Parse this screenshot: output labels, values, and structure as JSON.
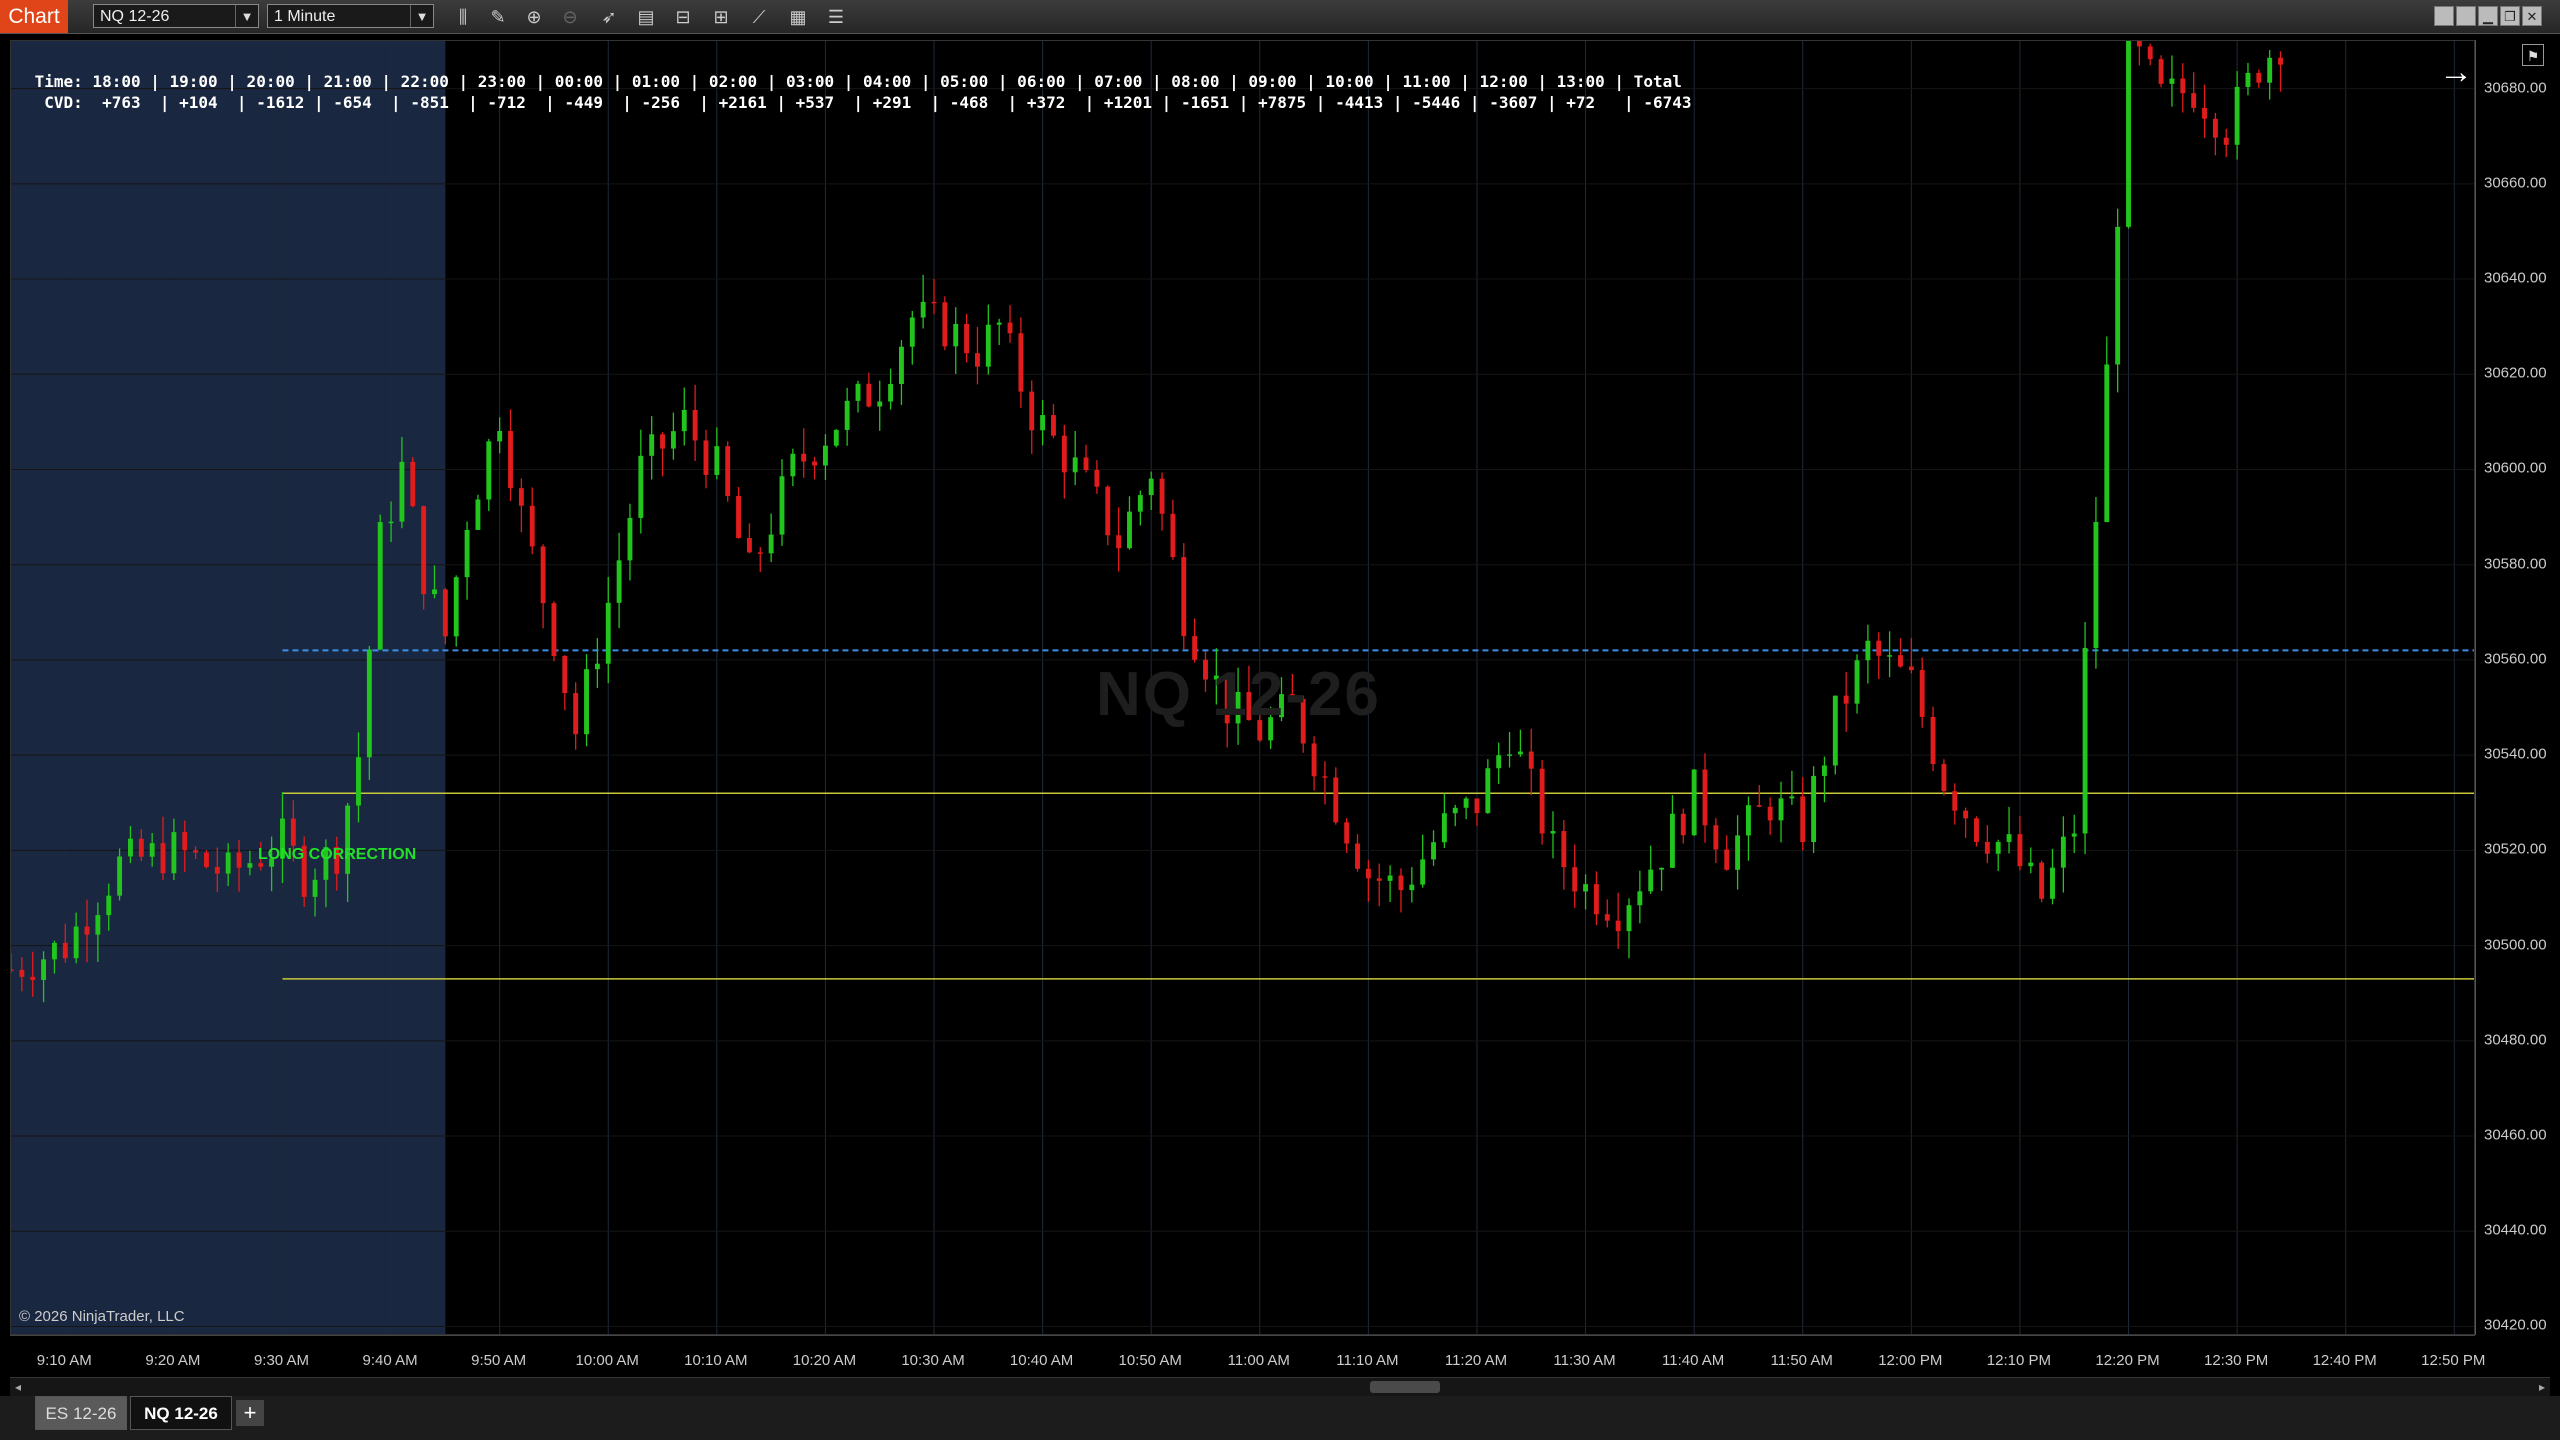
{
  "toolbar": {
    "app_label": "Chart",
    "instrument": "NQ 12-26",
    "interval": "1 Minute",
    "icons": [
      "bar-type-icon",
      "draw-pencil-icon",
      "zoom-in-icon",
      "zoom-out-icon",
      "pointer-icon",
      "properties-icon",
      "templates-icon",
      "strategy-icon",
      "indicators-icon",
      "calculator-icon",
      "list-icon"
    ],
    "window_icons": [
      "tile-icon",
      "maximize-panel-icon",
      "minimize-icon",
      "restore-icon",
      "close-icon"
    ]
  },
  "cvd": {
    "time_label": "Time:",
    "cvd_label": "CVD:",
    "columns": [
      {
        "time": "18:00",
        "cvd": "+763"
      },
      {
        "time": "19:00",
        "cvd": "+104"
      },
      {
        "time": "20:00",
        "cvd": "-1612"
      },
      {
        "time": "21:00",
        "cvd": "-654"
      },
      {
        "time": "22:00",
        "cvd": "-851"
      },
      {
        "time": "23:00",
        "cvd": "-712"
      },
      {
        "time": "00:00",
        "cvd": "-449"
      },
      {
        "time": "01:00",
        "cvd": "-256"
      },
      {
        "time": "02:00",
        "cvd": "+2161"
      },
      {
        "time": "03:00",
        "cvd": "+537"
      },
      {
        "time": "04:00",
        "cvd": "+291"
      },
      {
        "time": "05:00",
        "cvd": "-468"
      },
      {
        "time": "06:00",
        "cvd": "+372"
      },
      {
        "time": "07:00",
        "cvd": "+1201"
      },
      {
        "time": "08:00",
        "cvd": "-1651"
      },
      {
        "time": "09:00",
        "cvd": "+7875"
      },
      {
        "time": "10:00",
        "cvd": "-4413"
      },
      {
        "time": "11:00",
        "cvd": "-5446"
      },
      {
        "time": "12:00",
        "cvd": "-3607"
      },
      {
        "time": "13:00",
        "cvd": "+72"
      },
      {
        "time": "Total",
        "cvd": "-6743"
      }
    ]
  },
  "chart": {
    "watermark": "NQ 12-26",
    "annotation": "LONG CORRECTION",
    "copyright": "© 2026 NinjaTrader, LLC",
    "colors": {
      "up": "#22c41e",
      "down": "#e01c1c",
      "premarket_shade": "#1a2740",
      "dashed_line": "#3b8fe8",
      "level_line": "#c8c83a",
      "grid": "#1c1c1c"
    },
    "price_ticks": [
      "30680.00",
      "30660.00",
      "30640.00",
      "30620.00",
      "30600.00",
      "30580.00",
      "30560.00",
      "30540.00",
      "30520.00",
      "30500.00",
      "30480.00",
      "30460.00",
      "30440.00",
      "30420.00"
    ],
    "time_ticks": [
      "9:10 AM",
      "9:20 AM",
      "9:30 AM",
      "9:40 AM",
      "9:50 AM",
      "10:00 AM",
      "10:10 AM",
      "10:20 AM",
      "10:30 AM",
      "10:40 AM",
      "10:50 AM",
      "11:00 AM",
      "11:10 AM",
      "11:20 AM",
      "11:30 AM",
      "11:40 AM",
      "11:50 AM",
      "12:00 PM",
      "12:10 PM",
      "12:20 PM",
      "12:30 PM",
      "12:40 PM",
      "12:50 PM"
    ]
  },
  "chart_data": {
    "type": "candlestick",
    "ylim": [
      30418,
      30690
    ],
    "x_start": "9:05 AM",
    "x_end": "12:52 PM",
    "premarket_end": "9:45 AM",
    "levels": {
      "dashed": 30562,
      "upper": 30532,
      "lower": 30493
    },
    "level_start": "9:30 AM",
    "close_path": [
      [
        "9:05",
        30495
      ],
      [
        "9:10",
        30500
      ],
      [
        "9:15",
        30517
      ],
      [
        "9:20",
        30520
      ],
      [
        "9:25",
        30515
      ],
      [
        "9:30",
        30522
      ],
      [
        "9:32",
        30515
      ],
      [
        "9:35",
        30520
      ],
      [
        "9:37",
        30540
      ],
      [
        "9:39",
        30585
      ],
      [
        "9:41",
        30600
      ],
      [
        "9:43",
        30578
      ],
      [
        "9:45",
        30565
      ],
      [
        "9:47",
        30590
      ],
      [
        "9:50",
        30612
      ],
      [
        "9:52",
        30590
      ],
      [
        "9:55",
        30565
      ],
      [
        "9:57",
        30545
      ],
      [
        "10:00",
        30572
      ],
      [
        "10:03",
        30600
      ],
      [
        "10:07",
        30610
      ],
      [
        "10:10",
        30600
      ],
      [
        "10:13",
        30578
      ],
      [
        "10:17",
        30600
      ],
      [
        "10:21",
        30610
      ],
      [
        "10:25",
        30618
      ],
      [
        "10:28",
        30632
      ],
      [
        "10:31",
        30630
      ],
      [
        "10:34",
        30625
      ],
      [
        "10:36",
        30630
      ],
      [
        "10:39",
        30612
      ],
      [
        "10:43",
        30600
      ],
      [
        "10:47",
        30585
      ],
      [
        "10:50",
        30600
      ],
      [
        "10:53",
        30570
      ],
      [
        "10:57",
        30550
      ],
      [
        "11:00",
        30545
      ],
      [
        "11:03",
        30550
      ],
      [
        "11:07",
        30530
      ],
      [
        "11:10",
        30515
      ],
      [
        "11:13",
        30512
      ],
      [
        "11:17",
        30525
      ],
      [
        "11:20",
        30530
      ],
      [
        "11:23",
        30545
      ],
      [
        "11:27",
        30520
      ],
      [
        "11:30",
        30512
      ],
      [
        "11:33",
        30508
      ],
      [
        "11:37",
        30520
      ],
      [
        "11:40",
        30532
      ],
      [
        "11:43",
        30520
      ],
      [
        "11:47",
        30530
      ],
      [
        "11:50",
        30525
      ],
      [
        "11:53",
        30548
      ],
      [
        "11:56",
        30562
      ],
      [
        "12:00",
        30555
      ],
      [
        "12:03",
        30535
      ],
      [
        "12:06",
        30525
      ],
      [
        "12:09",
        30520
      ],
      [
        "12:12",
        30510
      ],
      [
        "12:15",
        30525
      ],
      [
        "12:16",
        30560
      ],
      [
        "12:18",
        30620
      ],
      [
        "12:20",
        30690
      ],
      [
        "12:23",
        30678
      ],
      [
        "12:26",
        30680
      ],
      [
        "12:29",
        30672
      ],
      [
        "12:32",
        30685
      ],
      [
        "12:34",
        30690
      ]
    ]
  },
  "tabs": [
    {
      "label": "ES 12-26",
      "active": false
    },
    {
      "label": "NQ 12-26",
      "active": true
    }
  ],
  "add_tab_label": "+"
}
